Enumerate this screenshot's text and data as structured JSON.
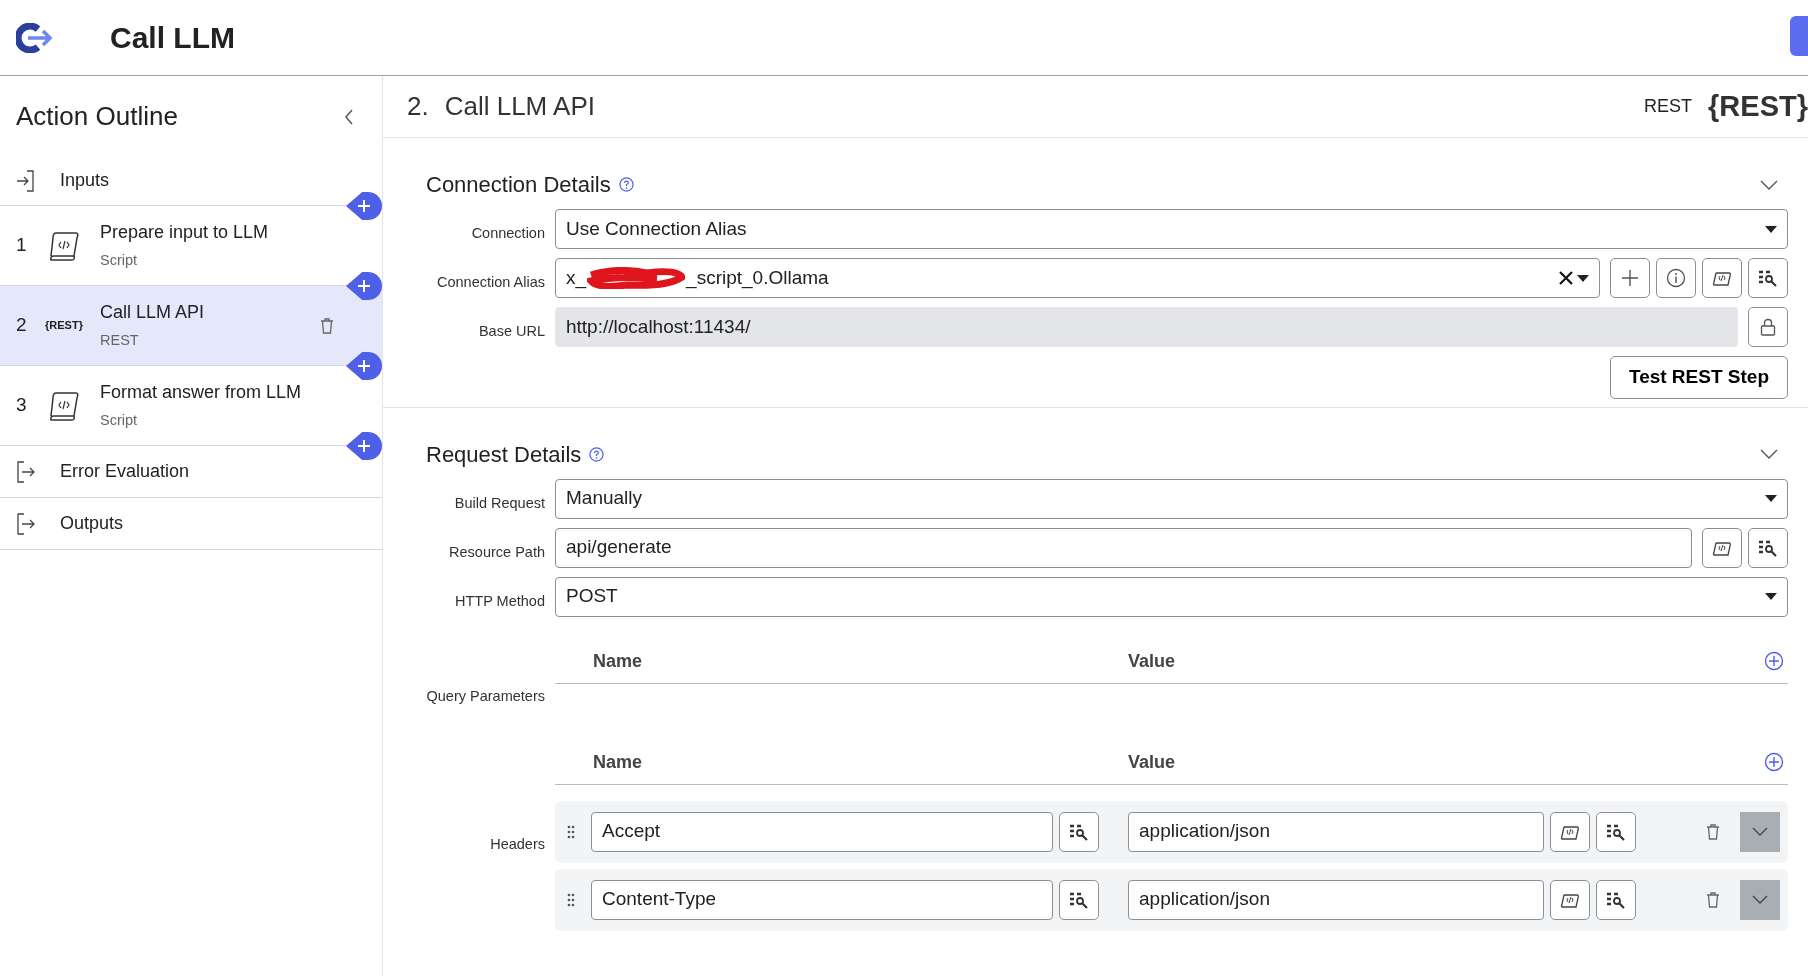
{
  "app": {
    "title": "Call LLM"
  },
  "sidebar": {
    "title": "Action Outline",
    "items": [
      {
        "kind": "inputs",
        "label": "Inputs"
      },
      {
        "kind": "script",
        "number": "1",
        "label": "Prepare input to LLM",
        "type": "Script",
        "selected": false
      },
      {
        "kind": "rest",
        "number": "2",
        "logo": "{REST}",
        "label": "Call LLM API",
        "type": "REST",
        "selected": true
      },
      {
        "kind": "script",
        "number": "3",
        "label": "Format answer from LLM",
        "type": "Script",
        "selected": false
      },
      {
        "kind": "error",
        "label": "Error Evaluation"
      },
      {
        "kind": "outputs",
        "label": "Outputs"
      }
    ]
  },
  "step": {
    "number": "2.",
    "title": "Call LLM API",
    "type": "REST",
    "logo": "{REST}"
  },
  "sections": [
    {
      "title": "Connection Details",
      "expanded": true,
      "fields": [
        {
          "kind": "select",
          "label": "Connection",
          "value": "Use Connection Alias"
        },
        {
          "kind": "alias",
          "label": "Connection Alias",
          "value_start": "x_",
          "value_end": "_script_0.Ollama",
          "redacted": true
        },
        {
          "kind": "readonly",
          "label": "Base URL",
          "value": "http://localhost:11434/"
        }
      ],
      "button": "Test REST Step"
    },
    {
      "title": "Request Details",
      "expanded": true,
      "fields": [
        {
          "kind": "select",
          "label": "Build Request",
          "value": "Manually"
        },
        {
          "kind": "text",
          "label": "Resource Path",
          "value": "api/generate"
        },
        {
          "kind": "select",
          "label": "HTTP Method",
          "value": "POST"
        },
        {
          "kind": "table",
          "label": "Query Parameters",
          "columns": [
            "Name",
            "Value"
          ]
        },
        {
          "kind": "table",
          "label": "Headers",
          "columns": [
            "Name",
            "Value"
          ],
          "rows": [
            {
              "name": "Accept",
              "value": "application/json"
            },
            {
              "name": "Content-Type",
              "value": "application/json"
            }
          ]
        }
      ]
    }
  ]
}
